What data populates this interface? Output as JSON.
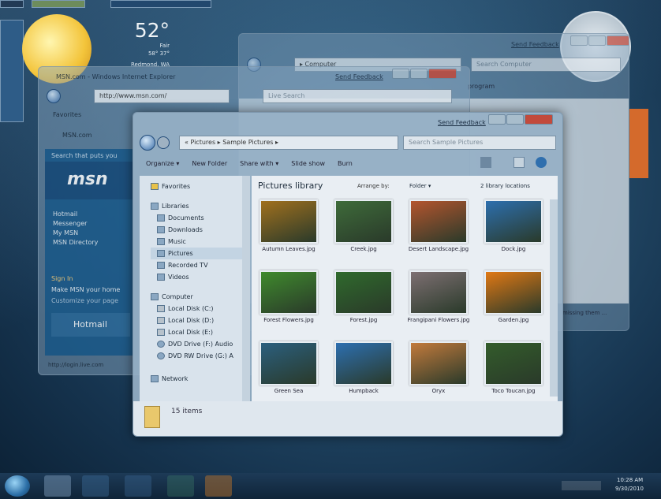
{
  "weather": {
    "temp": "52°",
    "hi_lo": "58° 37°",
    "location": "Redmond, WA",
    "condition": "Fair"
  },
  "back_window": {
    "feedback": "Send Feedback",
    "address": "▸ Computer",
    "search_placeholder": "Search Computer",
    "toolbar_item": "program",
    "status_text": "missing them ..."
  },
  "ie_window": {
    "title": "MSN.com - Windows Internet Explorer",
    "feedback": "Send Feedback",
    "address": "http://www.msn.com/",
    "search_placeholder": "Live Search",
    "favorites": "Favorites",
    "tab": "MSN.com",
    "search_hint": "Search that puts you",
    "logo": "msn",
    "links": [
      "Hotmail",
      "Messenger",
      "My MSN",
      "MSN Directory"
    ],
    "sign_in": "Sign In",
    "make_msn": "Make MSN your home",
    "customize": "Customize your page",
    "hotmail_banner": "Hotmail",
    "statusbar": "http://login.live.com"
  },
  "explorer": {
    "feedback": "Send Feedback",
    "breadcrumb": "« Pictures ▸ Sample Pictures ▸",
    "search_placeholder": "Search Sample Pictures",
    "toolbar": [
      "Organize ▾",
      "New Folder",
      "Share with ▾",
      "Slide show",
      "Burn"
    ],
    "nav": {
      "favorites": "Favorites",
      "libraries": "Libraries",
      "library_items": [
        "Documents",
        "Downloads",
        "Music",
        "Pictures",
        "Recorded TV",
        "Videos"
      ],
      "computer": "Computer",
      "drives": [
        "Local Disk (C:)",
        "Local Disk (D:)",
        "Local Disk (E:)",
        "DVD Drive (F:) Audio",
        "DVD RW Drive (G:) A"
      ],
      "network": "Network"
    },
    "library_title": "Pictures library",
    "arrange_label": "Arrange by:",
    "arrange_value": "Folder ▾",
    "locations": "2 library locations",
    "pictures": [
      {
        "name": "Autumn Leaves.jpg",
        "color": "#a0701e"
      },
      {
        "name": "Creek.jpg",
        "color": "#3e6b3a"
      },
      {
        "name": "Desert Landscape.jpg",
        "color": "#b4552e"
      },
      {
        "name": "Dock.jpg",
        "color": "#2d6fae"
      },
      {
        "name": "Forest Flowers.jpg",
        "color": "#3f8a2d"
      },
      {
        "name": "Forest.jpg",
        "color": "#2f6a2c"
      },
      {
        "name": "Frangipani Flowers.jpg",
        "color": "#7d6f72"
      },
      {
        "name": "Garden.jpg",
        "color": "#e07814"
      },
      {
        "name": "Green Sea",
        "color": "#2b5f7e"
      },
      {
        "name": "Humpback",
        "color": "#2d6fb0"
      },
      {
        "name": "Oryx",
        "color": "#c27a3c"
      },
      {
        "name": "Toco Toucan.jpg",
        "color": "#335c2b"
      }
    ],
    "item_count": "15 items"
  },
  "taskbar": {
    "time": "10:28 AM",
    "date": "9/30/2010"
  }
}
